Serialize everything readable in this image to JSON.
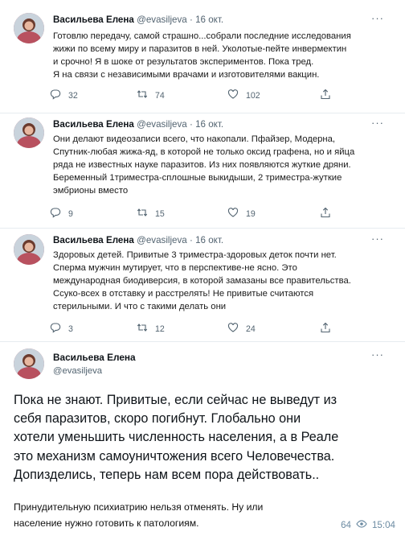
{
  "tweets": [
    {
      "name": "Васильева Елена",
      "handle": "@evasiljeva",
      "dot": "·",
      "date": "16 окт.",
      "more": "···",
      "lines": [
        "Готовлю передачу, самой страшно...собрали последние исследования",
        "жижи по всему миру и паразитов в ней. Уколотые-пейте инвермектин",
        "и срочно! Я в шоке от результатов экспериментов. Пока тред.",
        "Я на связи с независимыми врачами и изготовителями вакцин."
      ],
      "replies": "32",
      "retweets": "74",
      "likes": "102"
    },
    {
      "name": "Васильева Елена",
      "handle": "@evasiljeva",
      "dot": "·",
      "date": "16 окт.",
      "more": "···",
      "lines": [
        "Они делают видеозаписи всего, что накопали. Пфайзер, Модерна,",
        "Спутник-любая жижа-яд, в которой не только оксид графена, но и яйца",
        "ряда не известных науке паразитов. Из них появляются жуткие дряни.",
        "Беременный 1триместра-сплошные выкидыши, 2 триместра-жуткие",
        "эмбрионы вместо"
      ],
      "replies": "9",
      "retweets": "15",
      "likes": "19"
    },
    {
      "name": "Васильева Елена",
      "handle": "@evasiljeva",
      "dot": "·",
      "date": "16 окт.",
      "more": "···",
      "lines": [
        "Здоровых детей. Привитые 3 триместра-здоровых деток почти нет.",
        "Сперма мужчин мутирует, что в перспективе-не ясно. Это",
        "международная биодиверсия, в которой замазаны все правительства.",
        "Ссуко-всех в отставку и расстрелять! Не привитые считаются",
        "стерильными. И что с такими делать они"
      ],
      "replies": "3",
      "retweets": "12",
      "likes": "24"
    }
  ],
  "main_tweet": {
    "name": "Васильева Елена",
    "handle": "@evasiljeva",
    "more": "···",
    "lines": [
      "Пока не знают. Привитые, если сейчас не выведут из",
      "себя паразитов, скоро погибнут. Глобально они",
      "хотели уменьшить численность населения, а в Реале",
      "это механизм самоуничтожения всего Человечества.",
      "Допизделись, теперь нам всем пора действовать.."
    ]
  },
  "caption": {
    "lines": [
      "Принудительную психиатрию нельзя отменять. Ну или",
      "население нужно готовить к патологиям."
    ],
    "views": "64",
    "time": "15:04"
  },
  "colors": {
    "accent_meta": "#6d8ca3",
    "secondary": "#536471",
    "avatar_bg": "#b8515f"
  },
  "icons": [
    "reply-icon",
    "retweet-icon",
    "like-icon",
    "share-icon",
    "eye-icon"
  ]
}
